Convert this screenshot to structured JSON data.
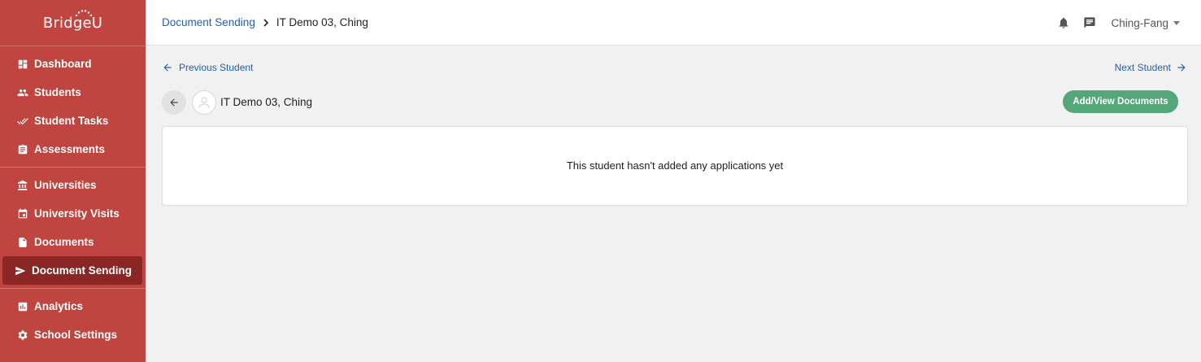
{
  "app": {
    "logo_text": "BridgeU"
  },
  "sidebar": {
    "groups": [
      [
        {
          "label": "Dashboard",
          "icon": "dashboard-icon"
        },
        {
          "label": "Students",
          "icon": "people-icon"
        },
        {
          "label": "Student Tasks",
          "icon": "double-check-icon"
        },
        {
          "label": "Assessments",
          "icon": "clipboard-icon"
        }
      ],
      [
        {
          "label": "Universities",
          "icon": "university-icon"
        },
        {
          "label": "University Visits",
          "icon": "calendar-icon"
        },
        {
          "label": "Documents",
          "icon": "document-icon"
        },
        {
          "label": "Document Sending",
          "icon": "send-icon",
          "active": true
        }
      ],
      [
        {
          "label": "Analytics",
          "icon": "bar-chart-icon"
        },
        {
          "label": "School Settings",
          "icon": "gear-icon"
        }
      ]
    ]
  },
  "topbar": {
    "breadcrumb": {
      "parent": "Document Sending",
      "current": "IT Demo 03, Ching"
    },
    "icons": [
      "bell-icon",
      "message-icon"
    ],
    "user": "Ching-Fang"
  },
  "main": {
    "prev_label": "Previous Student",
    "next_label": "Next Student",
    "student_name": "IT Demo 03, Ching",
    "add_button": "Add/View Documents",
    "empty_message": "This student hasn't added any applications yet"
  },
  "colors": {
    "sidebar": "#c0443f",
    "sidebar_active": "#8a2623",
    "link": "#2261b5",
    "button_green": "#55a77a"
  }
}
